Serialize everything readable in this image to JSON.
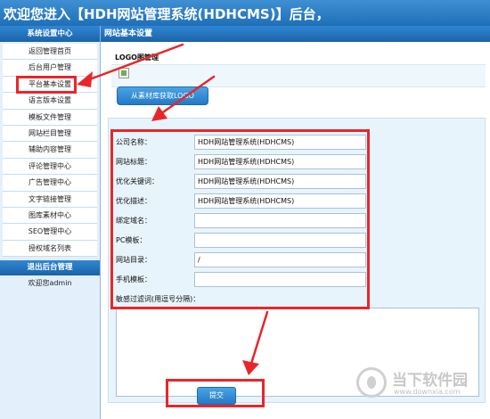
{
  "header": {
    "title": "欢迎您进入【HDH网站管理系统(HDHCMS)】后台，"
  },
  "sidebar": {
    "heading": "系统设置中心",
    "items": [
      {
        "label": "返回管理首页"
      },
      {
        "label": "后台用户管理"
      },
      {
        "label": "平台基本设置"
      },
      {
        "label": "语言版本设置"
      },
      {
        "label": "模板文件管理"
      },
      {
        "label": "网站栏目管理"
      },
      {
        "label": "辅助内容管理"
      },
      {
        "label": "评论管理中心"
      },
      {
        "label": "广告管理中心"
      },
      {
        "label": "文字链接管理"
      },
      {
        "label": "图库素材中心"
      },
      {
        "label": "SEO管理中心"
      },
      {
        "label": "授权域名列表"
      }
    ],
    "exit_label": "退出后台管理",
    "welcome": "欢迎您admin"
  },
  "main": {
    "heading": "网站基本设置",
    "logo_title": "LOGO图管理",
    "logo_button": "从素材库获取LOGO",
    "fields": [
      {
        "label": "公司名称：",
        "value": "HDH网站管理系统(HDHCMS)"
      },
      {
        "label": "网站标题：",
        "value": "HDH网站管理系统(HDHCMS)"
      },
      {
        "label": "优化关键词：",
        "value": "HDH网站管理系统(HDHCMS)"
      },
      {
        "label": "优化描述：",
        "value": "HDH网站管理系统(HDHCMS)"
      },
      {
        "label": "绑定域名：",
        "value": ""
      },
      {
        "label": "PC模板：",
        "value": ""
      },
      {
        "label": "网站目录：",
        "value": "/"
      },
      {
        "label": "手机模板：",
        "value": ""
      }
    ],
    "sensitive_label": "敏感过滤词(用逗号分隔)：",
    "submit_label": "提交"
  },
  "watermark": {
    "text": "当下软件园",
    "url": "www.downxia.com"
  },
  "colors": {
    "accent": "#2479c4",
    "annotation": "#e8262a",
    "form_bg": "#e8f4fb"
  }
}
